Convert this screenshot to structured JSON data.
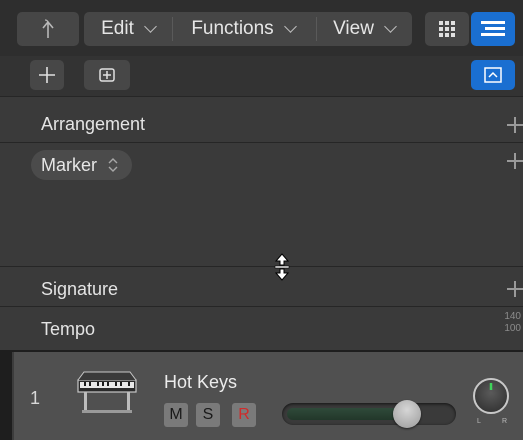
{
  "toolbar": {
    "edit_label": "Edit",
    "functions_label": "Functions",
    "view_label": "View"
  },
  "global_tracks": {
    "arrangement_label": "Arrangement",
    "marker_label": "Marker",
    "signature_label": "Signature",
    "tempo_label": "Tempo",
    "tempo_values": [
      "140",
      "100"
    ]
  },
  "track": {
    "number": "1",
    "name": "Hot Keys",
    "mute_label": "M",
    "solo_label": "S",
    "record_label": "R",
    "volume_fraction": 0.7,
    "pan_l": "L",
    "pan_r": "R"
  },
  "colors": {
    "accent": "#1a6fd1",
    "record": "#d02a2a"
  }
}
